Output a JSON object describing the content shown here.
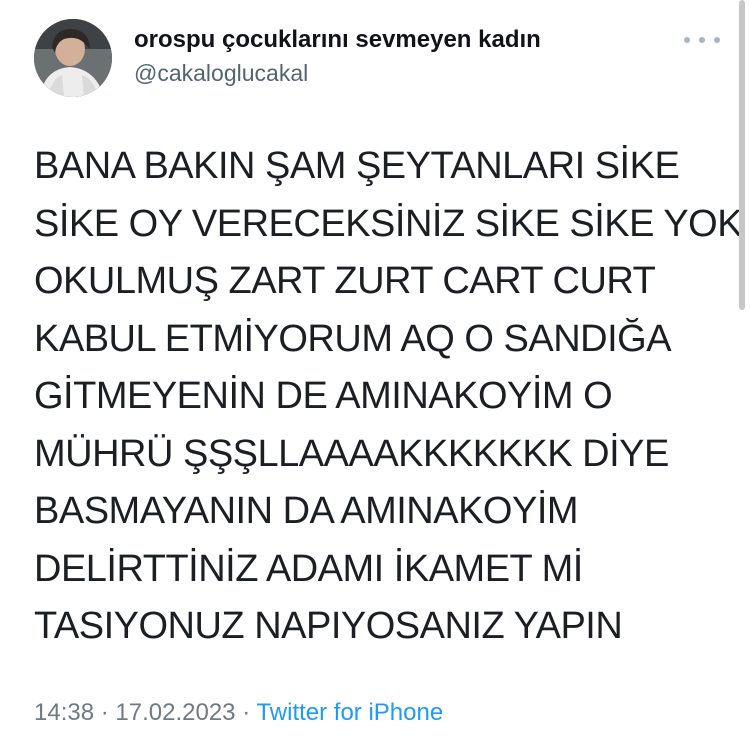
{
  "tweet": {
    "author": {
      "display_name": "orospu çocuklarını sevmeyen kadın",
      "handle": "@cakaloglucakal"
    },
    "text_lines": [
      "BANA BAKIN ŞAM ŞEYTANLARI SİKE",
      "SİKE OY VERECEKSİNİZ SİKE SİKE YOK",
      "OKULMUŞ ZART ZURT CART CURT",
      "KABUL ETMİYORUM AQ O SANDIĞA",
      "GİTMEYENİN DE AMINAKOYİM O",
      "MÜHRÜ ŞŞŞLLAAAAKKKKKKK DİYE",
      "BASMAYANIN DA AMINAKOYİM",
      "DELİRTTİNİZ ADAMI İKAMET Mİ",
      "TASIYONUZ NAPIYOSANIZ YAPIN"
    ],
    "time": "14:38",
    "separator": "·",
    "date": "17.02.2023",
    "source": "Twitter for iPhone"
  },
  "icons": {
    "more": "more-horizontal-icon"
  },
  "colors": {
    "text": "#0f1419",
    "secondary": "#536471",
    "meta": "#6e7a84",
    "link": "#1d9bf0"
  }
}
